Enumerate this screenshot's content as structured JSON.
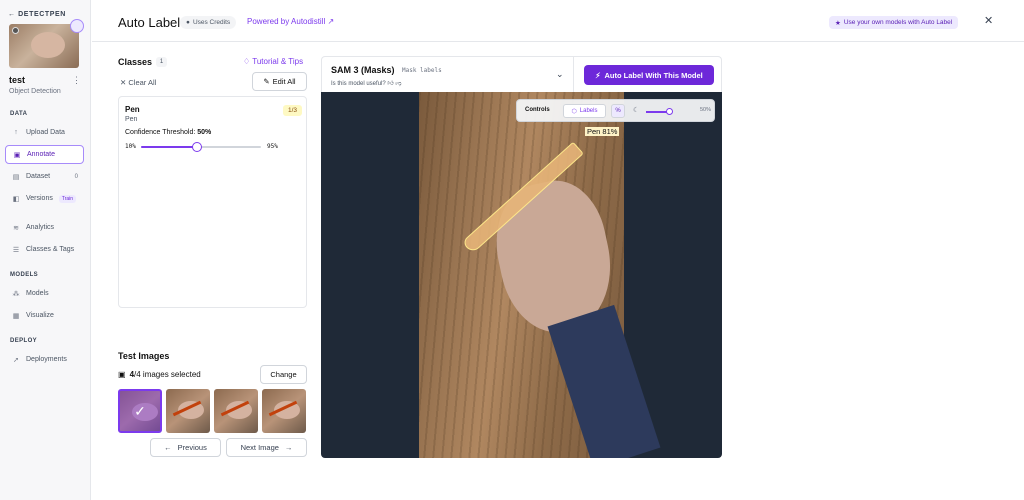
{
  "sidebar": {
    "back_label": "DETECTPEN",
    "project_name": "test",
    "project_type": "Object Detection",
    "sections": {
      "data": "DATA",
      "models": "MODELS",
      "deploy": "DEPLOY"
    },
    "items": {
      "upload": "Upload Data",
      "annotate": "Annotate",
      "dataset": "Dataset",
      "dataset_count": "0",
      "versions": "Versions",
      "versions_badge": "Train",
      "analytics": "Analytics",
      "classes_tags": "Classes & Tags",
      "models": "Models",
      "visualize": "Visualize",
      "deployments": "Deployments"
    }
  },
  "header": {
    "title": "Auto Label",
    "credits_badge": "Uses Credits",
    "powered_by": "Powered by Autodistill ↗",
    "own_models": "Use your own models with Auto Label",
    "close_icon": "close-icon"
  },
  "classes": {
    "heading": "Classes",
    "count": "1",
    "tutorial": "Tutorial & Tips",
    "clear_all": "Clear All",
    "edit_all": "Edit All",
    "card": {
      "name": "Pen",
      "prompt": "Pen",
      "ratio": "1/3",
      "confidence_label": "Confidence Threshold:",
      "confidence_value": "50%",
      "slider_min": "10%",
      "slider_max": "95%",
      "slider_fraction": 0.47
    }
  },
  "test_images": {
    "heading": "Test Images",
    "selected_count": "4",
    "selected_suffix": "/4 images selected",
    "change": "Change",
    "previous": "Previous",
    "next": "Next Image"
  },
  "model": {
    "name": "SAM 3 (Masks)",
    "tag": "Mask labels",
    "useful_prompt": "Is this model useful?",
    "auto_label_button": "Auto Label With This Model"
  },
  "canvas": {
    "detection_label": "Pen 81%",
    "controls": {
      "title": "Controls",
      "labels_toggle": "Labels",
      "percent_toggle": "%",
      "opacity_value": "50%"
    }
  },
  "colors": {
    "accent": "#7c3aed",
    "accent_dark": "#6d28d9",
    "mask": "#e6b478"
  }
}
